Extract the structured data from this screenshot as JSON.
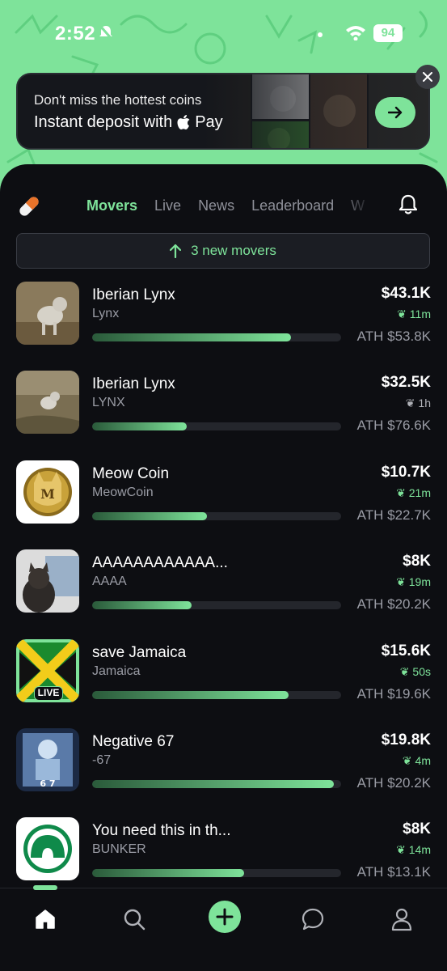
{
  "status_bar": {
    "time": "2:52",
    "battery": "94"
  },
  "promo_banner": {
    "line1": "Don't miss the hottest coins",
    "line2": "Instant deposit with",
    "pay_label": "Pay",
    "apple_glyph": ""
  },
  "tabs": [
    {
      "label": "Movers",
      "active": true
    },
    {
      "label": "Live",
      "active": false
    },
    {
      "label": "News",
      "active": false
    },
    {
      "label": "Leaderboard",
      "active": false
    },
    {
      "label": "W",
      "active": false
    }
  ],
  "new_movers": {
    "label": "3 new movers"
  },
  "coins": [
    {
      "name": "Iberian Lynx",
      "ticker": "Lynx",
      "price": "$43.1K",
      "age": "11m",
      "age_color": "green",
      "ath": "ATH $53.8K",
      "progress": 0.8
    },
    {
      "name": "Iberian Lynx",
      "ticker": "LYNX",
      "price": "$32.5K",
      "age": "1h",
      "age_color": "grey",
      "ath": "ATH $76.6K",
      "progress": 0.38
    },
    {
      "name": "Meow Coin",
      "ticker": "MeowCoin",
      "price": "$10.7K",
      "age": "21m",
      "age_color": "green",
      "ath": "ATH $22.7K",
      "progress": 0.46
    },
    {
      "name": "AAAAAAAAAAAA...",
      "ticker": "AAAA",
      "price": "$8K",
      "age": "19m",
      "age_color": "green",
      "ath": "ATH $20.2K",
      "progress": 0.4
    },
    {
      "name": "save Jamaica",
      "ticker": "Jamaica",
      "price": "$15.6K",
      "age": "50s",
      "age_color": "green",
      "ath": "ATH $19.6K",
      "progress": 0.79,
      "live_label": "LIVE"
    },
    {
      "name": "Negative 67",
      "ticker": "-67",
      "price": "$19.8K",
      "age": "4m",
      "age_color": "green",
      "ath": "ATH $20.2K",
      "progress": 0.97
    },
    {
      "name": "You need this in th...",
      "ticker": "BUNKER",
      "price": "$8K",
      "age": "14m",
      "age_color": "green",
      "ath": "ATH $13.1K",
      "progress": 0.61
    }
  ],
  "meow_thumb_letter": "M",
  "negative_thumb_text": "6 7",
  "bottom_nav": [
    "home-icon",
    "search-icon",
    "plus-icon",
    "chat-icon",
    "profile-icon"
  ],
  "colors": {
    "accent": "#7ee39a",
    "background": "#0d0e12",
    "muted": "#9a9ca5"
  }
}
